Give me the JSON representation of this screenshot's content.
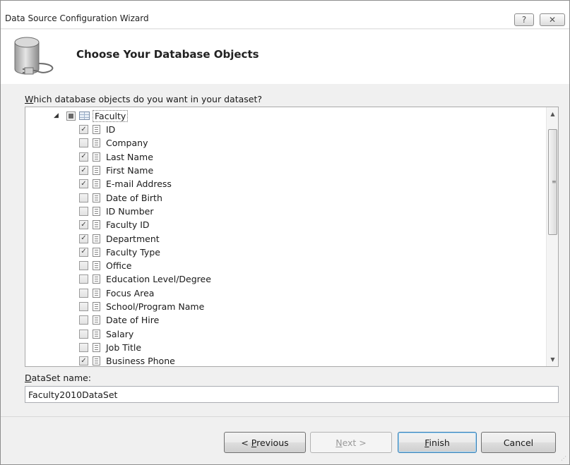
{
  "window": {
    "title": "Data Source Configuration Wizard",
    "help_glyph": "?",
    "close_glyph": "✕"
  },
  "header": {
    "title": "Choose Your Database Objects"
  },
  "prompt": "Which database objects do you want in your dataset?",
  "tree": {
    "root": {
      "label": "Faculty",
      "expanded": true,
      "state": "partial"
    },
    "fields": [
      {
        "label": "ID",
        "checked": true
      },
      {
        "label": "Company",
        "checked": false
      },
      {
        "label": "Last Name",
        "checked": true
      },
      {
        "label": "First Name",
        "checked": true
      },
      {
        "label": "E-mail Address",
        "checked": true
      },
      {
        "label": "Date of Birth",
        "checked": false
      },
      {
        "label": "ID Number",
        "checked": false
      },
      {
        "label": "Faculty ID",
        "checked": true
      },
      {
        "label": "Department",
        "checked": true
      },
      {
        "label": "Faculty Type",
        "checked": true
      },
      {
        "label": "Office",
        "checked": false
      },
      {
        "label": "Education Level/Degree",
        "checked": false
      },
      {
        "label": "Focus Area",
        "checked": false
      },
      {
        "label": "School/Program Name",
        "checked": false
      },
      {
        "label": "Date of Hire",
        "checked": false
      },
      {
        "label": "Salary",
        "checked": false
      },
      {
        "label": "Job Title",
        "checked": false
      },
      {
        "label": "Business Phone",
        "checked": true
      }
    ]
  },
  "dataset": {
    "label": "DataSet name:",
    "value": "Faculty2010DataSet"
  },
  "buttons": {
    "previous": "< Previous",
    "next": "Next >",
    "finish": "Finish",
    "cancel": "Cancel"
  }
}
